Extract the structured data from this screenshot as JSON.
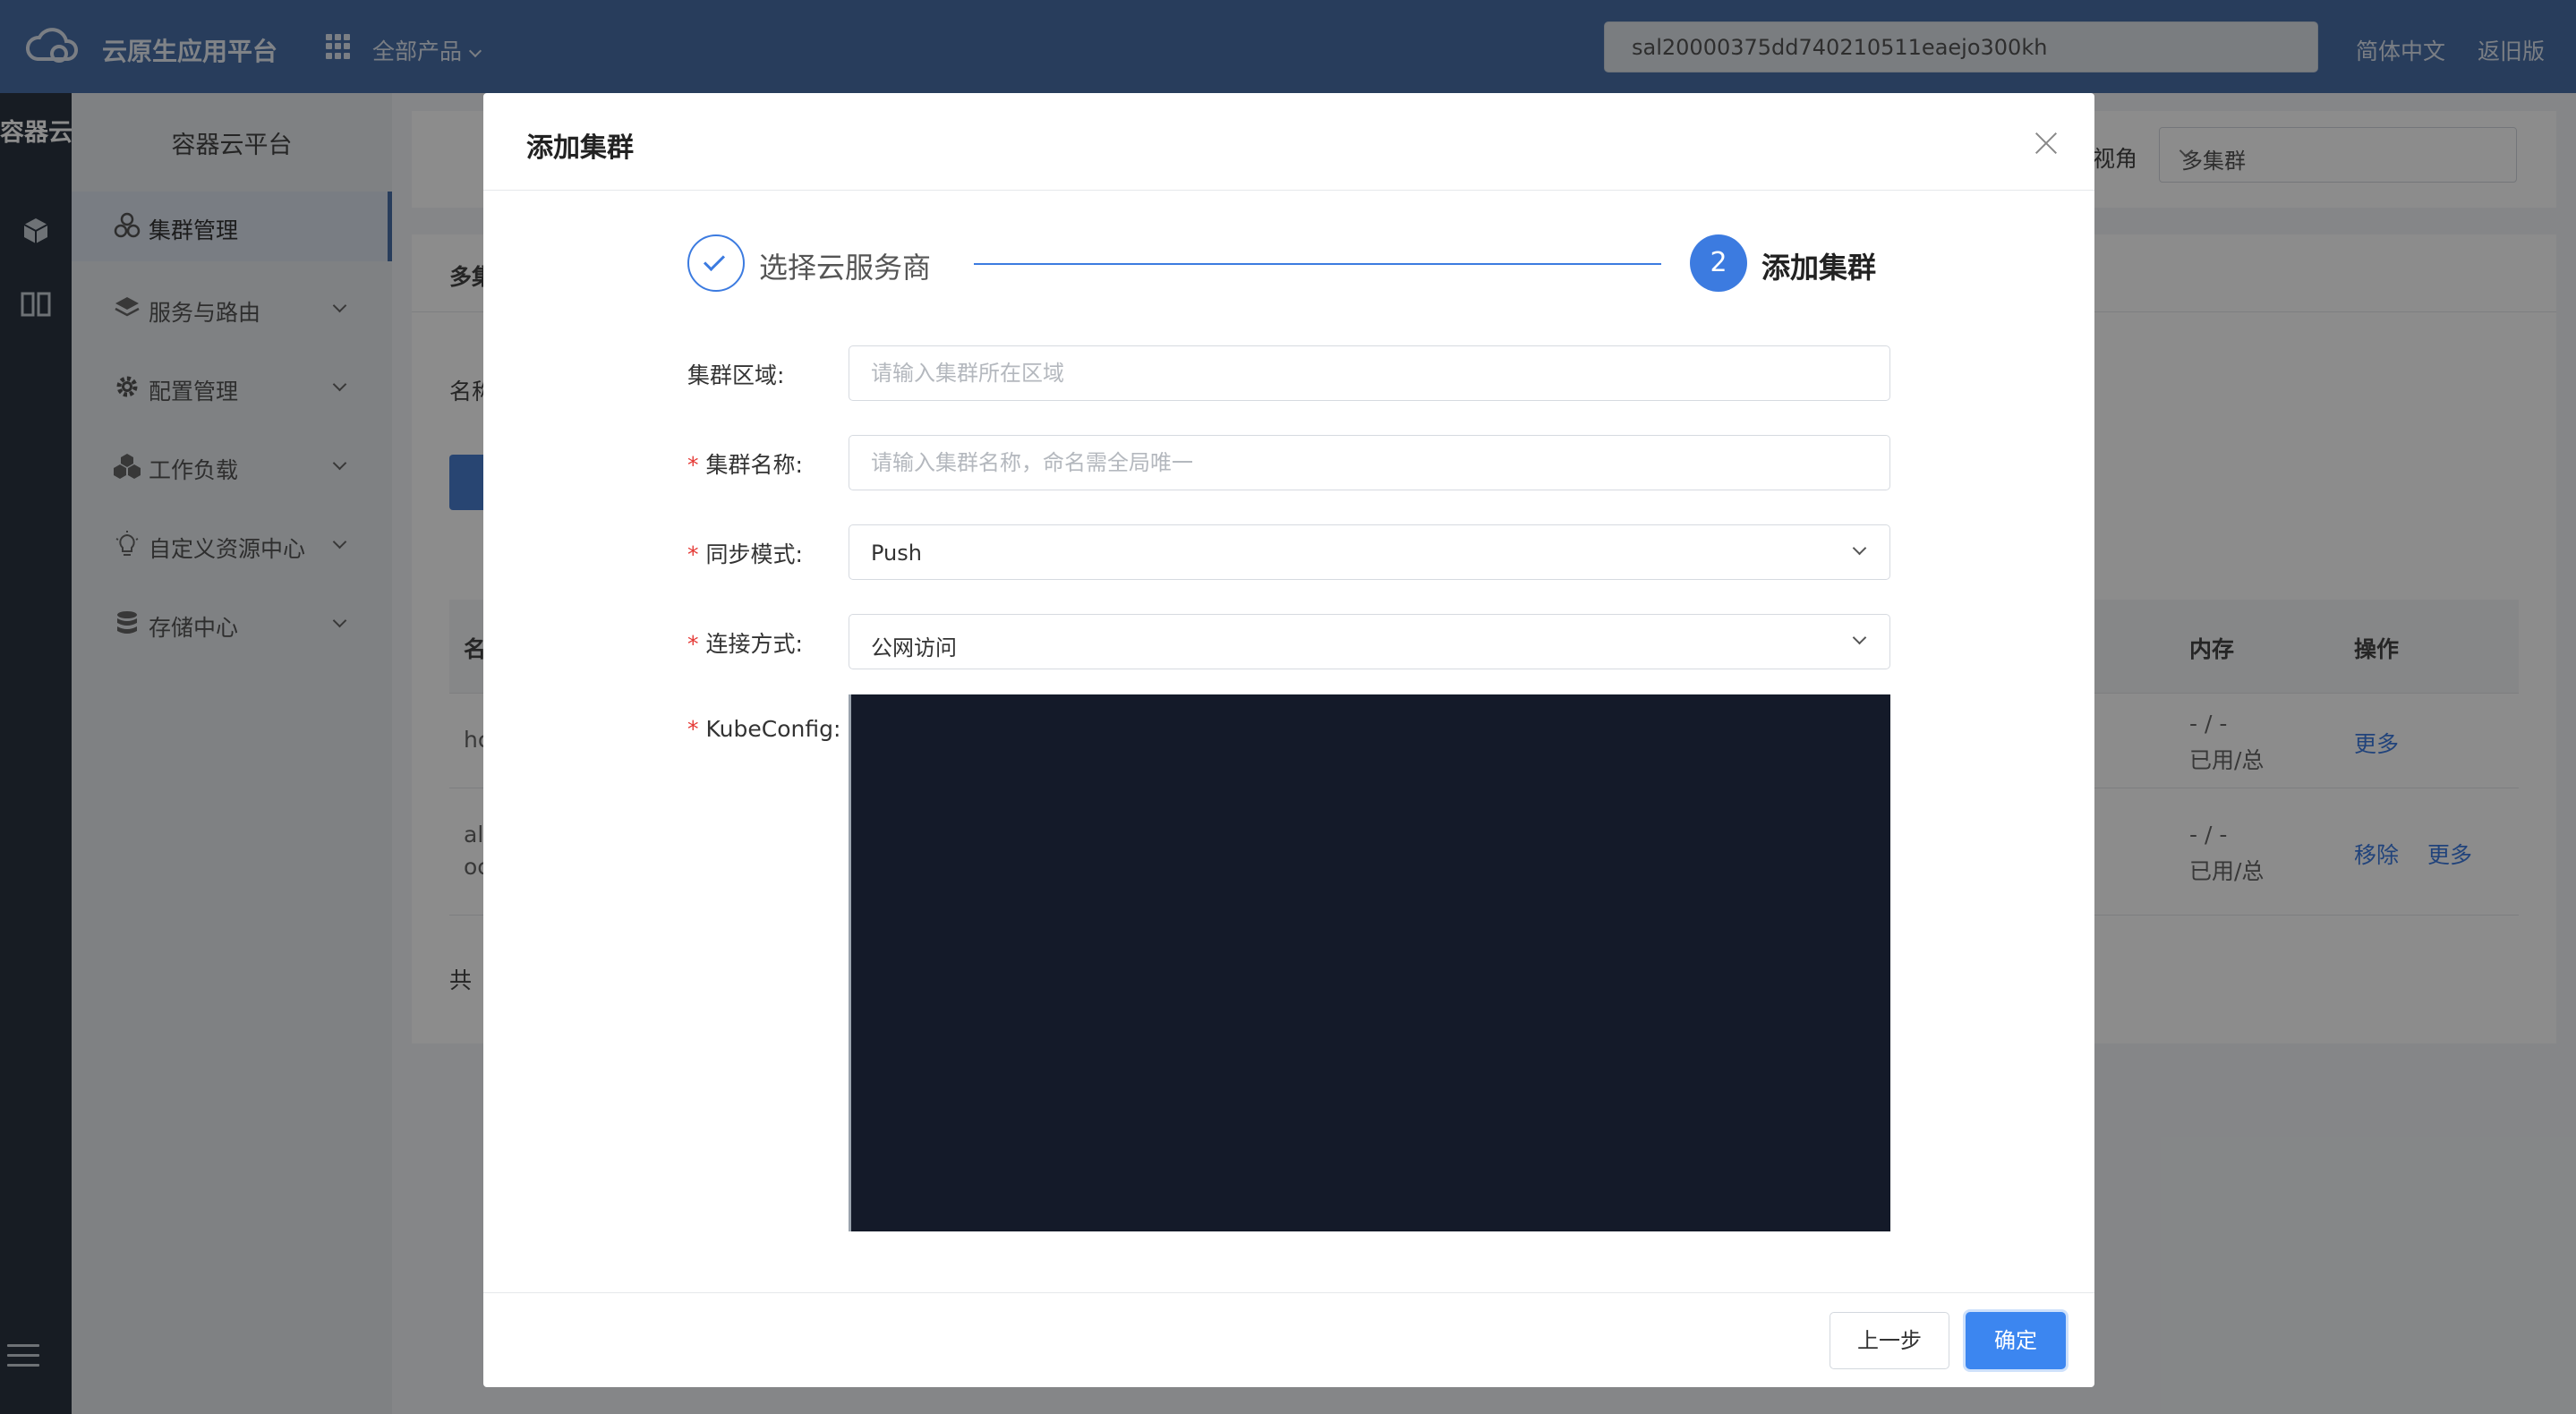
{
  "header": {
    "app_title": "云原生应用平台",
    "all_products": "全部产品",
    "search_value": "sal20000375dd740210511eaejo300kh",
    "language": "简体中文",
    "old_version": "返旧版"
  },
  "leftnav": {
    "brand": "容器云"
  },
  "sidebar": {
    "title": "容器云平台",
    "items": [
      {
        "label": "集群管理",
        "icon": "clusters-icon",
        "active": true
      },
      {
        "label": "服务与路由",
        "icon": "layers-icon"
      },
      {
        "label": "配置管理",
        "icon": "gear-icon"
      },
      {
        "label": "工作负载",
        "icon": "workloads-icon"
      },
      {
        "label": "自定义资源中心",
        "icon": "lightbulb-icon"
      },
      {
        "label": "存储中心",
        "icon": "database-icon"
      }
    ]
  },
  "background": {
    "view_label": "视角",
    "view_value": "多集群",
    "section_title": "多集",
    "name_label": "名称",
    "table": {
      "col_name": "名",
      "col_memory": "内存",
      "col_ops": "操作",
      "rows": [
        {
          "name": "hc",
          "memory_top": "- / -",
          "memory_bottom": "已用/总",
          "more": "更多"
        },
        {
          "name_line1": "al",
          "name_line2": "oc",
          "memory_top": "- / -",
          "memory_bottom": "已用/总",
          "remove": "移除",
          "more": "更多"
        }
      ]
    },
    "total_prefix": "共"
  },
  "modal": {
    "title": "添加集群",
    "steps": [
      {
        "label": "选择云服务商",
        "status": "done"
      },
      {
        "number": "2",
        "label": "添加集群",
        "status": "active"
      }
    ],
    "fields": {
      "region": {
        "label": "集群区域:",
        "placeholder": "请输入集群所在区域"
      },
      "name": {
        "label": "集群名称:",
        "placeholder": "请输入集群名称，命名需全局唯一"
      },
      "sync_mode": {
        "label": "同步模式:",
        "value": "Push"
      },
      "connection": {
        "label": "连接方式:",
        "value": "公网访问"
      },
      "kubeconfig": {
        "label": "KubeConfig:"
      }
    },
    "buttons": {
      "prev": "上一步",
      "confirm": "确定"
    }
  },
  "colors": {
    "primary": "#3c7be0",
    "topbar": "#4a70a8",
    "required": "#e53935",
    "editor_bg": "#141a29"
  }
}
